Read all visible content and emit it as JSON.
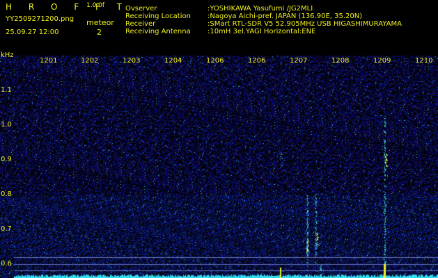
{
  "brand": "H R O F F T",
  "version": "1.0.0f",
  "filename": "YY2509271200.png",
  "datetime": "25.09.27 12:00",
  "meteor_label": "meteor",
  "meteor_count": "2",
  "info": [
    {
      "label": "Ovserver",
      "value": ":YOSHIKAWA Yasufumi /JG2MLI"
    },
    {
      "label": "Receiving Location",
      "value": ":Nagoya Aichi-pref. JAPAN (136.90E, 35.20N)"
    },
    {
      "label": "Receiver",
      "value": ":SMart RTL-SDR V5 52.905MHz USB HIGASHIMURAYAMA"
    },
    {
      "label": "Receiving Antenna",
      "value": ":10mH 3el.YAGI Horizontal:ENE"
    }
  ],
  "axis": {
    "y_unit": "kHz",
    "y_ticks": [
      "1.1",
      "1.0",
      "0.9",
      "0.8",
      "0.7",
      "0.6"
    ],
    "x_ticks": [
      "1201",
      "1202",
      "1203",
      "1204",
      "1206",
      "1206",
      "1207",
      "1208",
      "1209",
      "1210"
    ]
  },
  "colors": {
    "text": "#f0f020",
    "background": "#000000",
    "noise": "#1a2aa0",
    "baseline": "#30e0f0"
  }
}
